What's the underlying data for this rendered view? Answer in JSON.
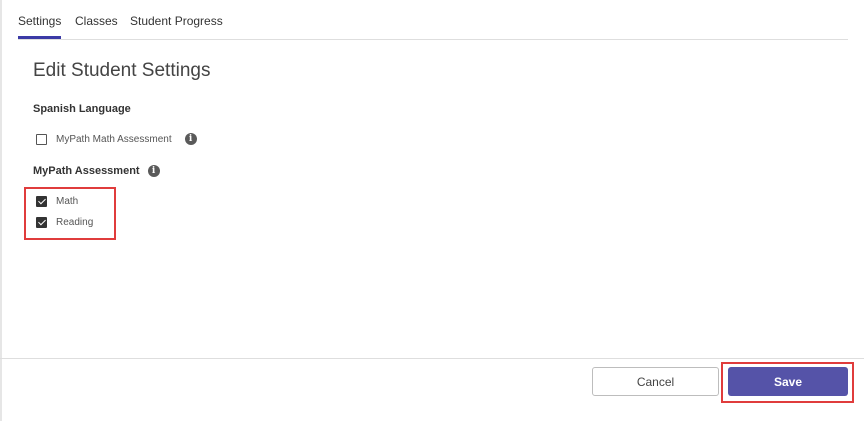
{
  "tabs": [
    {
      "label": "Settings",
      "active": true
    },
    {
      "label": "Classes",
      "active": false
    },
    {
      "label": "Student Progress",
      "active": false
    }
  ],
  "page_title": "Edit Student Settings",
  "spanish_language": {
    "label": "Spanish Language",
    "options": [
      {
        "label": "MyPath Math Assessment",
        "checked": false,
        "icon": "info-icon"
      }
    ]
  },
  "mypath_assessment": {
    "label": "MyPath Assessment",
    "icon": "info-icon",
    "options": [
      {
        "label": "Math",
        "checked": true
      },
      {
        "label": "Reading",
        "checked": true
      }
    ]
  },
  "footer": {
    "cancel_label": "Cancel",
    "save_label": "Save"
  },
  "colors": {
    "accent": "#5553a8",
    "tab_underline": "#3b3aa6",
    "highlight": "#e03c3c"
  }
}
